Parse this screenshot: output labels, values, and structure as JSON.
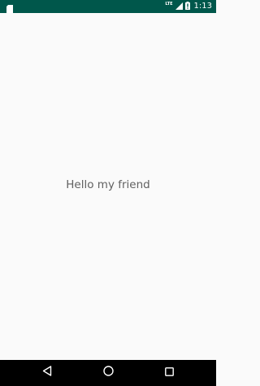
{
  "status_bar": {
    "network_badge": "LTE",
    "time": "1:13",
    "icons": [
      "sd-card-icon",
      "signal-icon",
      "battery-icon"
    ]
  },
  "main": {
    "greeting": "Hello my friend"
  },
  "navigation_bar": {
    "buttons": [
      "back-icon",
      "home-icon",
      "recent-apps-icon"
    ]
  },
  "colors": {
    "status_bar": "#00574b",
    "background": "#fafafa",
    "text": "#616161",
    "navigation_bar": "#000000"
  }
}
